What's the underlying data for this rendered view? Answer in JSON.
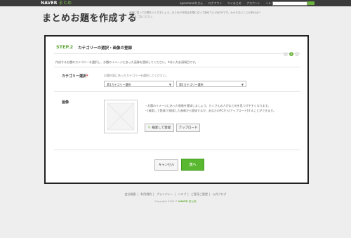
{
  "header": {
    "logo": "NAVER",
    "logo_sub": "まとめ",
    "nav": [
      "openmaaaちさん",
      "ログアウト",
      "マイまとめ",
      "アカウント",
      "ヘルプ"
    ]
  },
  "page": {
    "title": "まとめお題を作成する",
    "description": "画面に従ってお題をつくりましょう。まとめの作成は手順に沿って進めていけばOKです。わからないことがあればヘルプをご覧ください。"
  },
  "step": {
    "number": "STEP.2",
    "title": "カテゴリーの選択・画像の登録",
    "indicators": [
      "1",
      "2",
      "3"
    ],
    "active_index": 1
  },
  "intro": "作成するお題のカテゴリーを選択し、お題のイメージにあった画像を登録してください。※は入力必須項目です。",
  "category": {
    "label": "カテゴリー選択",
    "required_mark": "*",
    "help": "お題内容に合ったカテゴリーを選択してください。",
    "select1": "第1カテゴリー選択",
    "select2": "第2カテゴリー選択"
  },
  "image": {
    "label": "画像",
    "bullets": [
      "・お題のイメージにあった画像を登録しましょう。たくさんの人がまとめを見つけやすくなります。",
      "・[検索して登録]で検索した画像から登録するか、あなたのPCから[アップロード]することができます。"
    ],
    "search_button": "検索して登録",
    "upload_button": "アップロード"
  },
  "actions": {
    "cancel": "キャンセル",
    "next": "次へ"
  },
  "footer": {
    "links": [
      "会社概要",
      "利用規約",
      "プライバシー",
      "ヘルプ",
      "ご意見ご要望",
      "公式ブログ"
    ],
    "copyright_prefix": "Copyright 2009 ©",
    "copyright_brand": "NAVER まとめ"
  }
}
